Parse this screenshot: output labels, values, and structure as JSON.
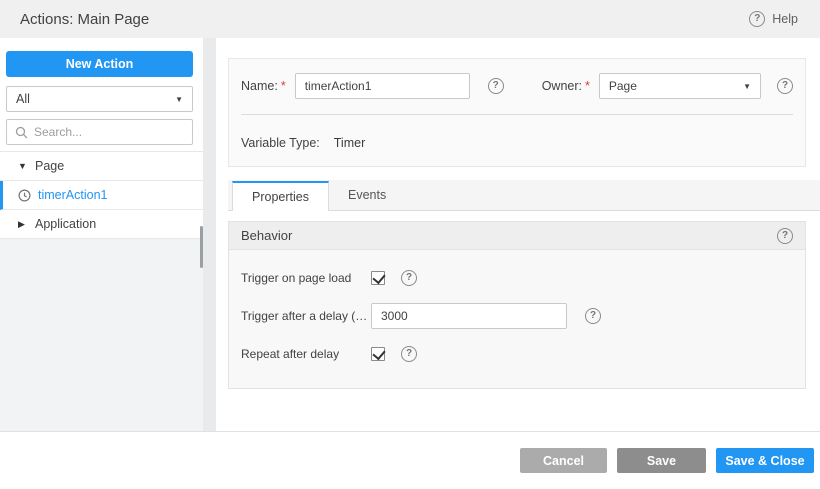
{
  "titlebar": {
    "title": "Actions: Main Page",
    "help_label": "Help",
    "help_icon_glyph": "?"
  },
  "sidebar": {
    "new_action_button": "New Action",
    "filter_dropdown_value": "All",
    "search_placeholder": "Search...",
    "tree": [
      {
        "label": "Page",
        "type": "group",
        "state": "expanded",
        "icon": "triangle-down"
      },
      {
        "label": "timerAction1",
        "type": "timer-action",
        "selected": true,
        "icon": "clock-icon"
      },
      {
        "label": "Application",
        "type": "group",
        "state": "collapsed",
        "icon": "triangle-right"
      }
    ]
  },
  "form": {
    "name_label": "Name:",
    "name_value": "timerAction1",
    "required_marker": "*",
    "owner_label": "Owner:",
    "owner_value": "Page",
    "variable_type_label": "Variable Type:",
    "variable_type_value": "Timer",
    "help_icon_glyph": "?"
  },
  "tabs": [
    {
      "label": "Properties",
      "active": true
    },
    {
      "label": "Events",
      "active": false
    }
  ],
  "behavior": {
    "section_title": "Behavior",
    "help_icon_glyph": "?",
    "rows": [
      {
        "label": "Trigger on page load",
        "control": "checkbox",
        "checked": true
      },
      {
        "label": "Trigger after a delay (millisec...",
        "control": "input",
        "value": "3000"
      },
      {
        "label": "Repeat after delay",
        "control": "checkbox",
        "checked": true
      }
    ]
  },
  "footer": {
    "cancel_label": "Cancel",
    "save_label": "Save",
    "save_close_label": "Save & Close"
  },
  "colors": {
    "accent_blue": "#2196f3",
    "cancel_gray": "#ababab",
    "save_gray": "#8d8d8d",
    "required_red": "#e53935",
    "titlebar_bg": "#f0f0f1",
    "panel_bg": "#fafafa",
    "section_header_bg": "#eeeeef",
    "section_body_bg": "#f8f8f9"
  }
}
